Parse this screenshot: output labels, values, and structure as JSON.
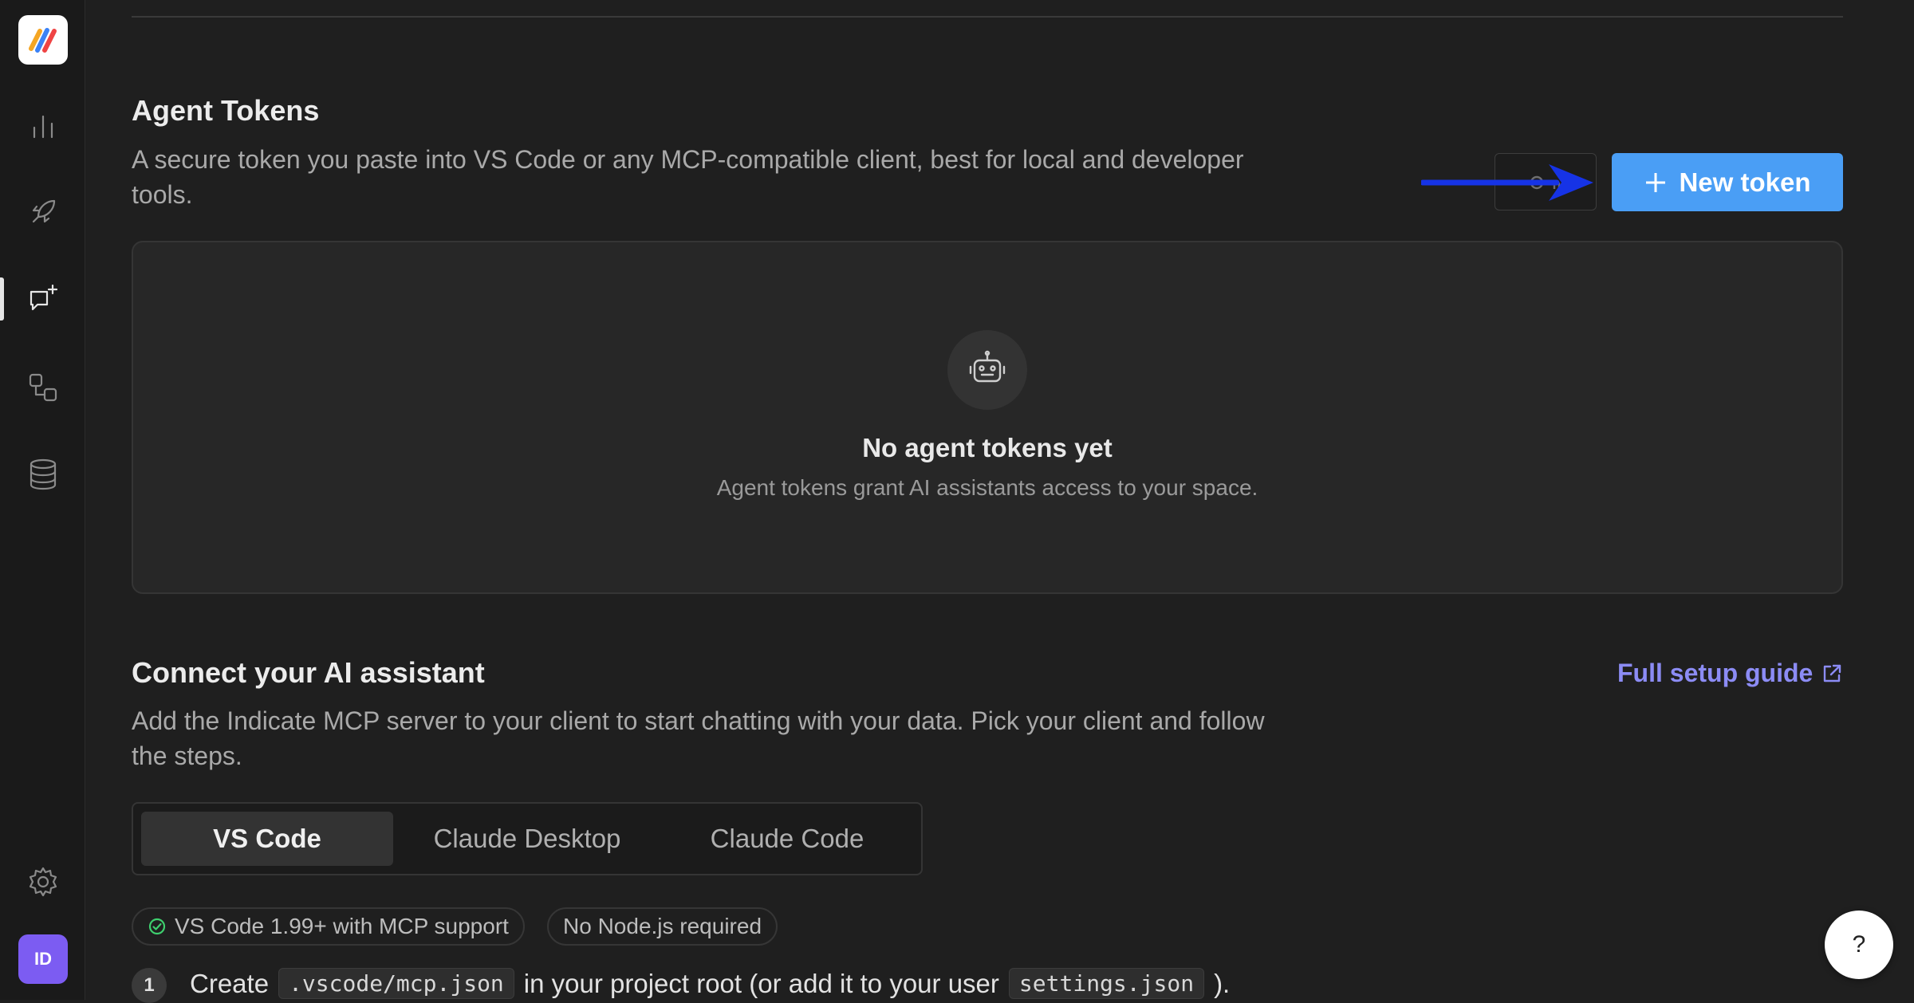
{
  "sidebar": {
    "avatar_initials": "ID",
    "items": [
      {
        "icon": "bar-chart-icon"
      },
      {
        "icon": "rocket-icon"
      },
      {
        "icon": "chat-sparkle-icon",
        "active": true
      },
      {
        "icon": "workflow-icon"
      },
      {
        "icon": "database-icon"
      },
      {
        "icon": "gear-icon"
      }
    ]
  },
  "agent_tokens": {
    "title": "Agent Tokens",
    "description_line1": "A secure token you paste into VS Code or any MCP-compatible client, best for local and developer",
    "description_line2": "tools.",
    "new_token_label": "New token",
    "empty_title": "No agent tokens yet",
    "empty_subtitle": "Agent tokens grant AI assistants access to your space."
  },
  "connect": {
    "title": "Connect your AI assistant",
    "description_line1": "Add the Indicate MCP server to your client to start chatting with your data. Pick your client and follow",
    "description_line2": "the steps.",
    "guide_link_label": "Full setup guide",
    "tabs": [
      {
        "label": "VS Code",
        "active": true
      },
      {
        "label": "Claude Desktop",
        "active": false
      },
      {
        "label": "Claude Code",
        "active": false
      }
    ],
    "requirements": [
      "VS Code 1.99+ with MCP support",
      "No Node.js required"
    ],
    "step1": {
      "number": "1",
      "prefix": "Create",
      "code1": ".vscode/mcp.json",
      "middle": "in your project root (or add it to your user",
      "code2": "settings.json",
      "suffix": ")."
    }
  },
  "help_label": "?",
  "colors": {
    "accent": "#4a9ef5",
    "link": "#8c8cf5",
    "annotation_arrow": "#1633e6",
    "avatar": "#7c5cf2"
  }
}
